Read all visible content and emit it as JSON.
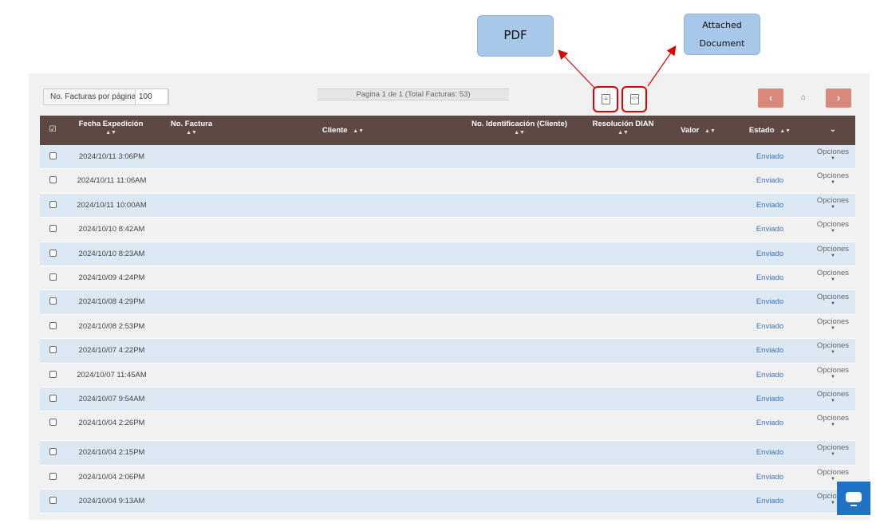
{
  "callouts": {
    "pdf": "PDF",
    "attached_line1": "Attached",
    "attached_line2": "Document"
  },
  "toolbar": {
    "per_page_label": "No. Facturas por página",
    "per_page_value": "100",
    "pagination_info": "Pagina 1 de 1 (Total Facturas: 53)",
    "prev_icon": "chevron-left-icon",
    "next_icon": "chevron-right-icon",
    "home_icon": "home-icon",
    "pdf_icon": "pdf-file-icon",
    "xml_icon": "code-file-icon",
    "prev_glyph": "‹",
    "next_glyph": "›",
    "home_glyph": "⌂"
  },
  "table": {
    "headers": {
      "fecha": "Fecha Expedición",
      "factura": "No. Factura",
      "cliente": "Cliente",
      "identificacion": "No. Identificación (Cliente)",
      "resolucion": "Resolución DIAN",
      "valor": "Valor",
      "estado": "Estado"
    },
    "header_color": "#5e4843",
    "rows": [
      {
        "fecha": "2024/10/11 3:06PM",
        "estado": "Enviado",
        "opciones": "Opciones"
      },
      {
        "fecha": "2024/10/11 11:06AM",
        "estado": "Enviado",
        "opciones": "Opciones"
      },
      {
        "fecha": "2024/10/11 10:00AM",
        "estado": "Enviado",
        "opciones": "Opciones"
      },
      {
        "fecha": "2024/10/10 8:42AM",
        "estado": "Enviado",
        "opciones": "Opciones"
      },
      {
        "fecha": "2024/10/10 8:23AM",
        "estado": "Enviado",
        "opciones": "Opciones"
      },
      {
        "fecha": "2024/10/09 4:24PM",
        "estado": "Enviado",
        "opciones": "Opciones"
      },
      {
        "fecha": "2024/10/08 4:29PM",
        "estado": "Enviado",
        "opciones": "Opciones"
      },
      {
        "fecha": "2024/10/08 2:53PM",
        "estado": "Enviado",
        "opciones": "Opciones"
      },
      {
        "fecha": "2024/10/07 4:22PM",
        "estado": "Enviado",
        "opciones": "Opciones"
      },
      {
        "fecha": "2024/10/07 11:45AM",
        "estado": "Enviado",
        "opciones": "Opciones"
      },
      {
        "fecha": "2024/10/07 9:54AM",
        "estado": "Enviado",
        "opciones": "Opciones"
      },
      {
        "fecha": "2024/10/04 2:26PM",
        "estado": "Enviado",
        "opciones": "Opciones"
      },
      {
        "fecha": "2024/10/04 2:15PM",
        "estado": "Enviado",
        "opciones": "Opciones"
      },
      {
        "fecha": "2024/10/04 2:06PM",
        "estado": "Enviado",
        "opciones": "Opciones"
      },
      {
        "fecha": "2024/10/04 9:13AM",
        "estado": "Enviado",
        "opciones": "Opciones"
      }
    ]
  },
  "chat_icon": "chat-bubble-icon"
}
